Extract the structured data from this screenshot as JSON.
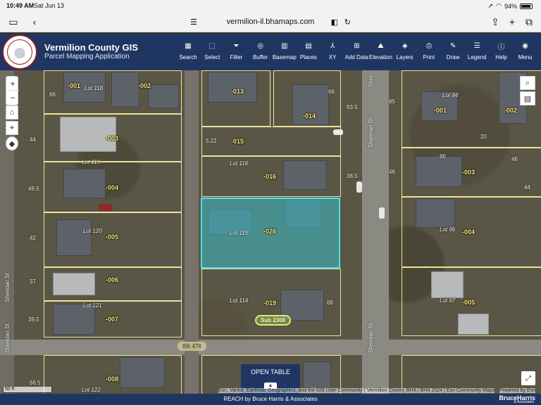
{
  "status": {
    "time": "10:49 AM",
    "date": "Sat Jun 13",
    "battery": "94%"
  },
  "browser": {
    "url": "vermilion-il.bhamaps.com"
  },
  "app": {
    "title": "Vermilion County GIS",
    "subtitle": "Parcel Mapping Application",
    "logo_text": "VERMILION COUNTY ILLINOIS"
  },
  "toolbar": [
    {
      "label": "Search",
      "icon": "search-icon"
    },
    {
      "label": "Select",
      "icon": "select-icon"
    },
    {
      "label": "Filter",
      "icon": "filter-icon"
    },
    {
      "label": "Buffer",
      "icon": "buffer-icon"
    },
    {
      "label": "Basemap",
      "icon": "basemap-icon"
    },
    {
      "label": "Places",
      "icon": "places-icon"
    },
    {
      "label": "XY",
      "icon": "xy-icon"
    },
    {
      "label": "Add Data",
      "icon": "add-data-icon"
    },
    {
      "label": "Elevation",
      "icon": "elevation-icon"
    },
    {
      "label": "Layers",
      "icon": "layers-icon"
    },
    {
      "label": "Print",
      "icon": "print-icon"
    },
    {
      "label": "Draw",
      "icon": "draw-icon"
    },
    {
      "label": "Legend",
      "icon": "legend-icon"
    },
    {
      "label": "Help",
      "icon": "help-icon"
    },
    {
      "label": "Menu",
      "icon": "menu-icon"
    }
  ],
  "parcels": {
    "p001": "-001",
    "p002": "-002",
    "p003": "-003",
    "p004": "-004",
    "p005": "-005",
    "p006": "-006",
    "p007": "-007",
    "p008": "-008",
    "p013": "-013",
    "p014": "-014",
    "p015": "-015",
    "p016": "-016",
    "p026": "-026",
    "p019": "-019",
    "r001": "-001",
    "r002": "-002",
    "r003": "-003",
    "r004": "-004",
    "r005": "-005"
  },
  "lots": {
    "l118": "Lot 118",
    "l119": "Lot 119",
    "l120": "Lot 120",
    "l121": "Lot 121",
    "l122": "Lot 122",
    "l116": "Lot 116",
    "l115": "Lot 115",
    "l114": "Lot 114",
    "l94": "Lot 94",
    "l96": "Lot 96",
    "l97": "Lot 97"
  },
  "dims": {
    "d66a": "66",
    "d44a": "44",
    "d495": "49.5",
    "d42": "42",
    "d37": "37",
    "d395": "39.5",
    "d66b": "66",
    "d665": "66.5",
    "d522": "5.22",
    "d935": "93.5",
    "d385": "38.5",
    "d66c": "66",
    "d85": "85",
    "d46a": "46",
    "d46b": "46",
    "d20": "20",
    "d86": "86",
    "d44b": "44"
  },
  "streets": {
    "sheridan1": "Sheridan St",
    "sheridan2": "Sheridan St",
    "sherman1": "Sherman St",
    "sherman2": "Sherman St",
    "sherman_top": "Sher"
  },
  "pills": {
    "blk": "Blk 478",
    "sub": "Sub 2366"
  },
  "map": {
    "zoom_in": "+",
    "zoom_out": "−",
    "open_table": "OPEN TABLE",
    "scale": "50 ft",
    "attribution": "Esri, Vantor, Earthstar Geographics, and the GIS User Community | Vermilion County, BHA | BHA 2024 | Esri Community Maps",
    "powered": "Powered by Esri"
  },
  "footer": {
    "text": "REACH by Bruce Harris & Associates",
    "brand": "BruceHarris",
    "brand_sub": "& Associates"
  }
}
